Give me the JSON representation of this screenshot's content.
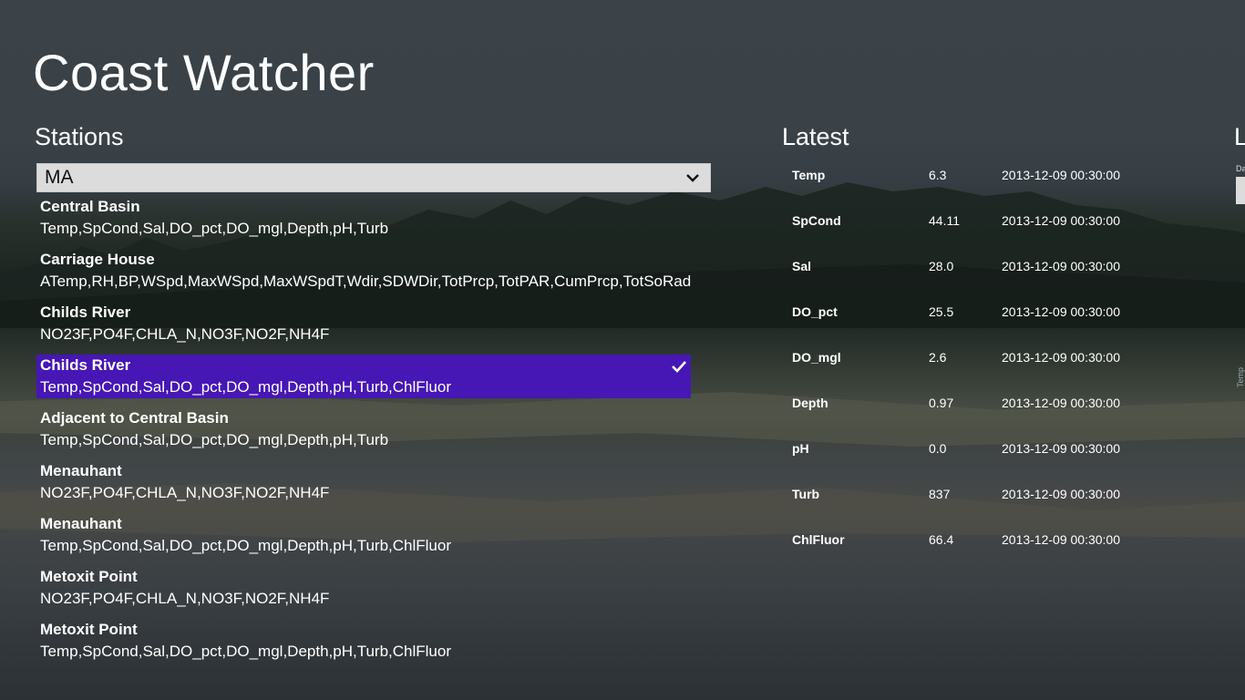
{
  "app": {
    "title": "Coast Watcher"
  },
  "stations": {
    "title": "Stations",
    "selected_state": "MA",
    "items": [
      {
        "name": "Central Basin",
        "params": "Temp,SpCond,Sal,DO_pct,DO_mgl,Depth,pH,Turb",
        "selected": false
      },
      {
        "name": "Carriage House",
        "params": "ATemp,RH,BP,WSpd,MaxWSpd,MaxWSpdT,Wdir,SDWDir,TotPrcp,TotPAR,CumPrcp,TotSoRad",
        "selected": false
      },
      {
        "name": "Childs River",
        "params": "NO23F,PO4F,CHLA_N,NO3F,NO2F,NH4F",
        "selected": false
      },
      {
        "name": "Childs River",
        "params": "Temp,SpCond,Sal,DO_pct,DO_mgl,Depth,pH,Turb,ChlFluor",
        "selected": true
      },
      {
        "name": "Adjacent to Central Basin",
        "params": "Temp,SpCond,Sal,DO_pct,DO_mgl,Depth,pH,Turb",
        "selected": false
      },
      {
        "name": "Menauhant",
        "params": "NO23F,PO4F,CHLA_N,NO3F,NO2F,NH4F",
        "selected": false
      },
      {
        "name": "Menauhant",
        "params": "Temp,SpCond,Sal,DO_pct,DO_mgl,Depth,pH,Turb,ChlFluor",
        "selected": false
      },
      {
        "name": "Metoxit Point",
        "params": "NO23F,PO4F,CHLA_N,NO3F,NO2F,NH4F",
        "selected": false
      },
      {
        "name": "Metoxit Point",
        "params": "Temp,SpCond,Sal,DO_pct,DO_mgl,Depth,pH,Turb,ChlFluor",
        "selected": false
      }
    ]
  },
  "latest": {
    "title": "Latest",
    "rows": [
      {
        "param": "Temp",
        "value": "6.3",
        "time": "2013-12-09 00:30:00"
      },
      {
        "param": "SpCond",
        "value": "44.11",
        "time": "2013-12-09 00:30:00"
      },
      {
        "param": "Sal",
        "value": "28.0",
        "time": "2013-12-09 00:30:00"
      },
      {
        "param": "DO_pct",
        "value": "25.5",
        "time": "2013-12-09 00:30:00"
      },
      {
        "param": "DO_mgl",
        "value": "2.6",
        "time": "2013-12-09 00:30:00"
      },
      {
        "param": "Depth",
        "value": "0.97",
        "time": "2013-12-09 00:30:00"
      },
      {
        "param": "pH",
        "value": "0.0",
        "time": "2013-12-09 00:30:00"
      },
      {
        "param": "Turb",
        "value": "837",
        "time": "2013-12-09 00:30:00"
      },
      {
        "param": "ChlFluor",
        "value": "66.4",
        "time": "2013-12-09 00:30:00"
      }
    ]
  },
  "offscreen": {
    "title_fragment": "L",
    "label_fragment": "Da",
    "vertical_label": "Temp"
  },
  "colors": {
    "selection": "#4617b4",
    "select_bg": "#dcdcdc"
  },
  "icons": {
    "dropdown": "chevron-down-icon",
    "selected": "checkmark-icon"
  }
}
